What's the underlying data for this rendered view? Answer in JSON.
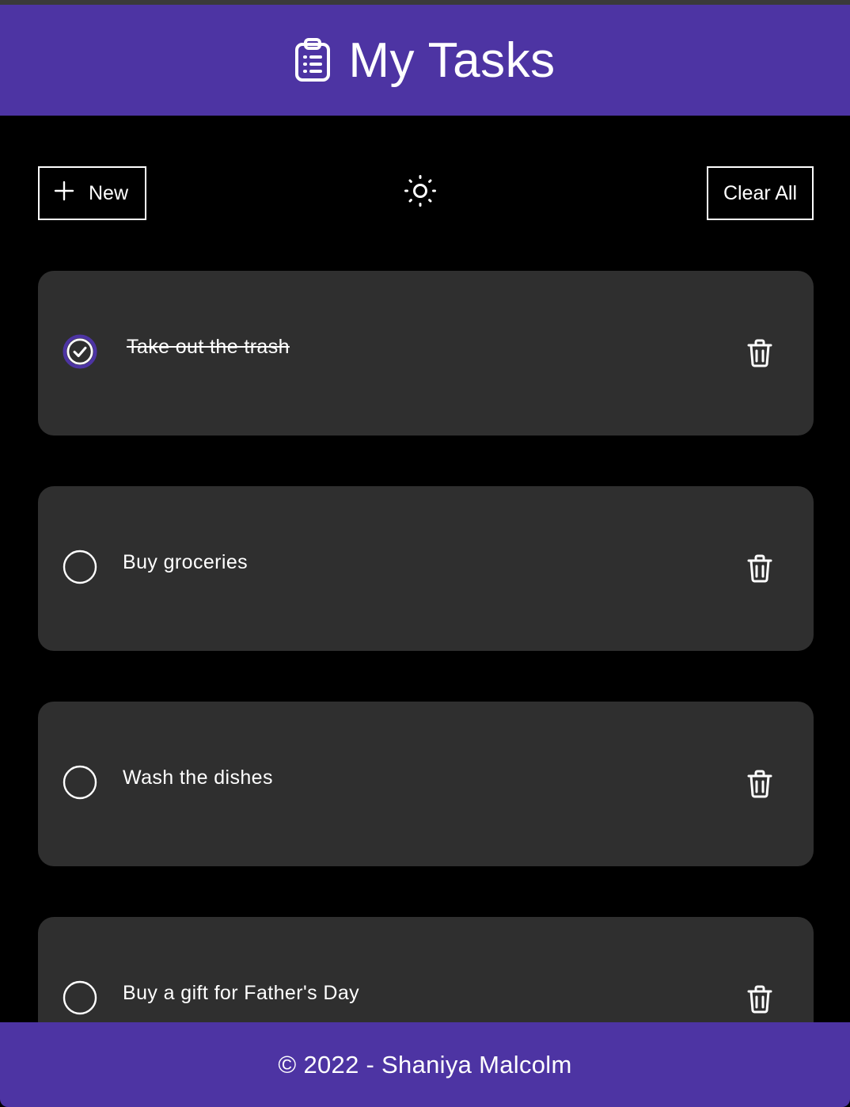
{
  "theme": {
    "accent": "#4d34a3",
    "background": "#000000",
    "card": "#2f2f2f",
    "text": "#ffffff"
  },
  "header": {
    "title": "My Tasks",
    "icon": "clipboard-list-icon"
  },
  "toolbar": {
    "new_label": "New",
    "new_icon": "plus-icon",
    "theme_icon": "sun-icon",
    "clear_label": "Clear All"
  },
  "tasks": [
    {
      "label": "Take out the trash",
      "completed": true
    },
    {
      "label": "Buy groceries",
      "completed": false
    },
    {
      "label": "Wash the dishes",
      "completed": false
    },
    {
      "label": "Buy a gift for Father's Day",
      "completed": false
    }
  ],
  "footer": {
    "text": "© 2022 - Shaniya Malcolm"
  }
}
